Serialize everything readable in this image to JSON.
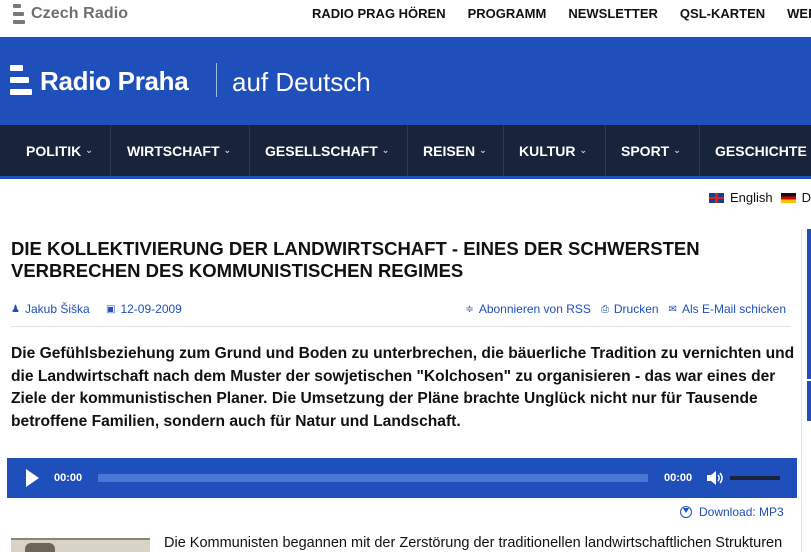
{
  "top": {
    "logo_text": "Czech Radio",
    "links": [
      "RADIO PRAG HÖREN",
      "PROGRAMM",
      "NEWSLETTER",
      "QSL-KARTEN",
      "WER IST"
    ]
  },
  "header": {
    "brand": "Radio Praha",
    "sub": "auf Deutsch",
    "color": "#1f4fba"
  },
  "nav": {
    "items": [
      "POLITIK",
      "WIRTSCHAFT",
      "GESELLSCHAFT",
      "REISEN",
      "KULTUR",
      "SPORT",
      "GESCHICHTE"
    ],
    "background": "#18243a"
  },
  "lang": {
    "english": "English",
    "german_partial": "D"
  },
  "article": {
    "title": "Die Kollektivierung der Landwirtschaft - eines der schwersten Verbrechen des kommunistischen Regimes",
    "author": "Jakub Šiška",
    "date": "12-09-2009",
    "rss": "Abonnieren von RSS",
    "print": "Drucken",
    "email": "Als E-Mail schicken",
    "lead": "Die Gefühlsbeziehung zum Grund und Boden zu unterbrechen, die bäuerliche Tradition zu vernichten und die Landwirtschaft nach dem Muster der sowjetischen \"Kolchosen\" zu organisieren - das war eines der Ziele der kommunistischen Planer. Die Umsetzung der Pläne brachte Unglück nicht nur für Tausende betroffene Familien, sondern auch für Natur und Landschaft.",
    "body_start": "Die Kommunisten begannen mit der Zerstörung der traditionellen landwirtschaftlichen Strukturen"
  },
  "player": {
    "current_time": "00:00",
    "duration": "00:00",
    "progress": 0,
    "download": "Download: MP3"
  }
}
